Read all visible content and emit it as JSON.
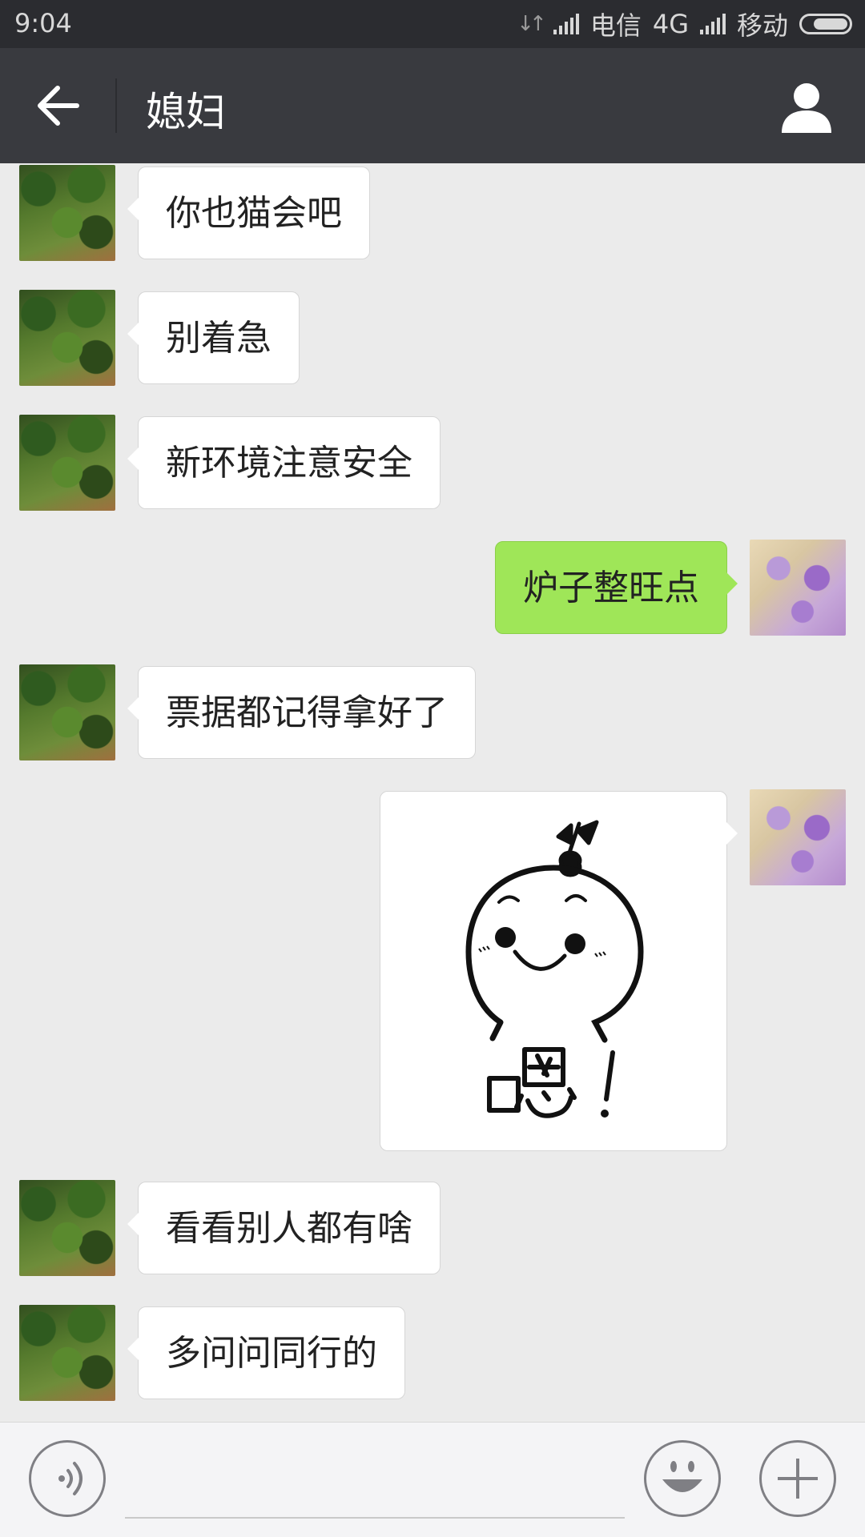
{
  "status_bar": {
    "time": "9:04",
    "carrier_1": "电信",
    "network": "4G",
    "carrier_2": "移动"
  },
  "header": {
    "title": "媳妇",
    "back_icon": "arrow-left-icon",
    "profile_icon": "person-icon"
  },
  "messages": [
    {
      "side": "left",
      "text": "你也猫会吧"
    },
    {
      "side": "left",
      "text": "别着急"
    },
    {
      "side": "left",
      "text": "新环境注意安全"
    },
    {
      "side": "right",
      "text": "炉子整旺点"
    },
    {
      "side": "left",
      "text": "票据都记得拿好了"
    },
    {
      "side": "right",
      "type": "sticker",
      "text": "嗯！"
    },
    {
      "side": "left",
      "text": "看看别人都有啥"
    },
    {
      "side": "left",
      "text": "多问问同行的"
    }
  ],
  "input_bar": {
    "voice_icon": "voice-icon",
    "emoji_icon": "emoji-icon",
    "plus_icon": "plus-icon"
  },
  "colors": {
    "sent_bubble": "#9fe658",
    "received_bubble": "#ffffff",
    "header": "#393a3f",
    "chat_bg": "#ebebeb"
  }
}
